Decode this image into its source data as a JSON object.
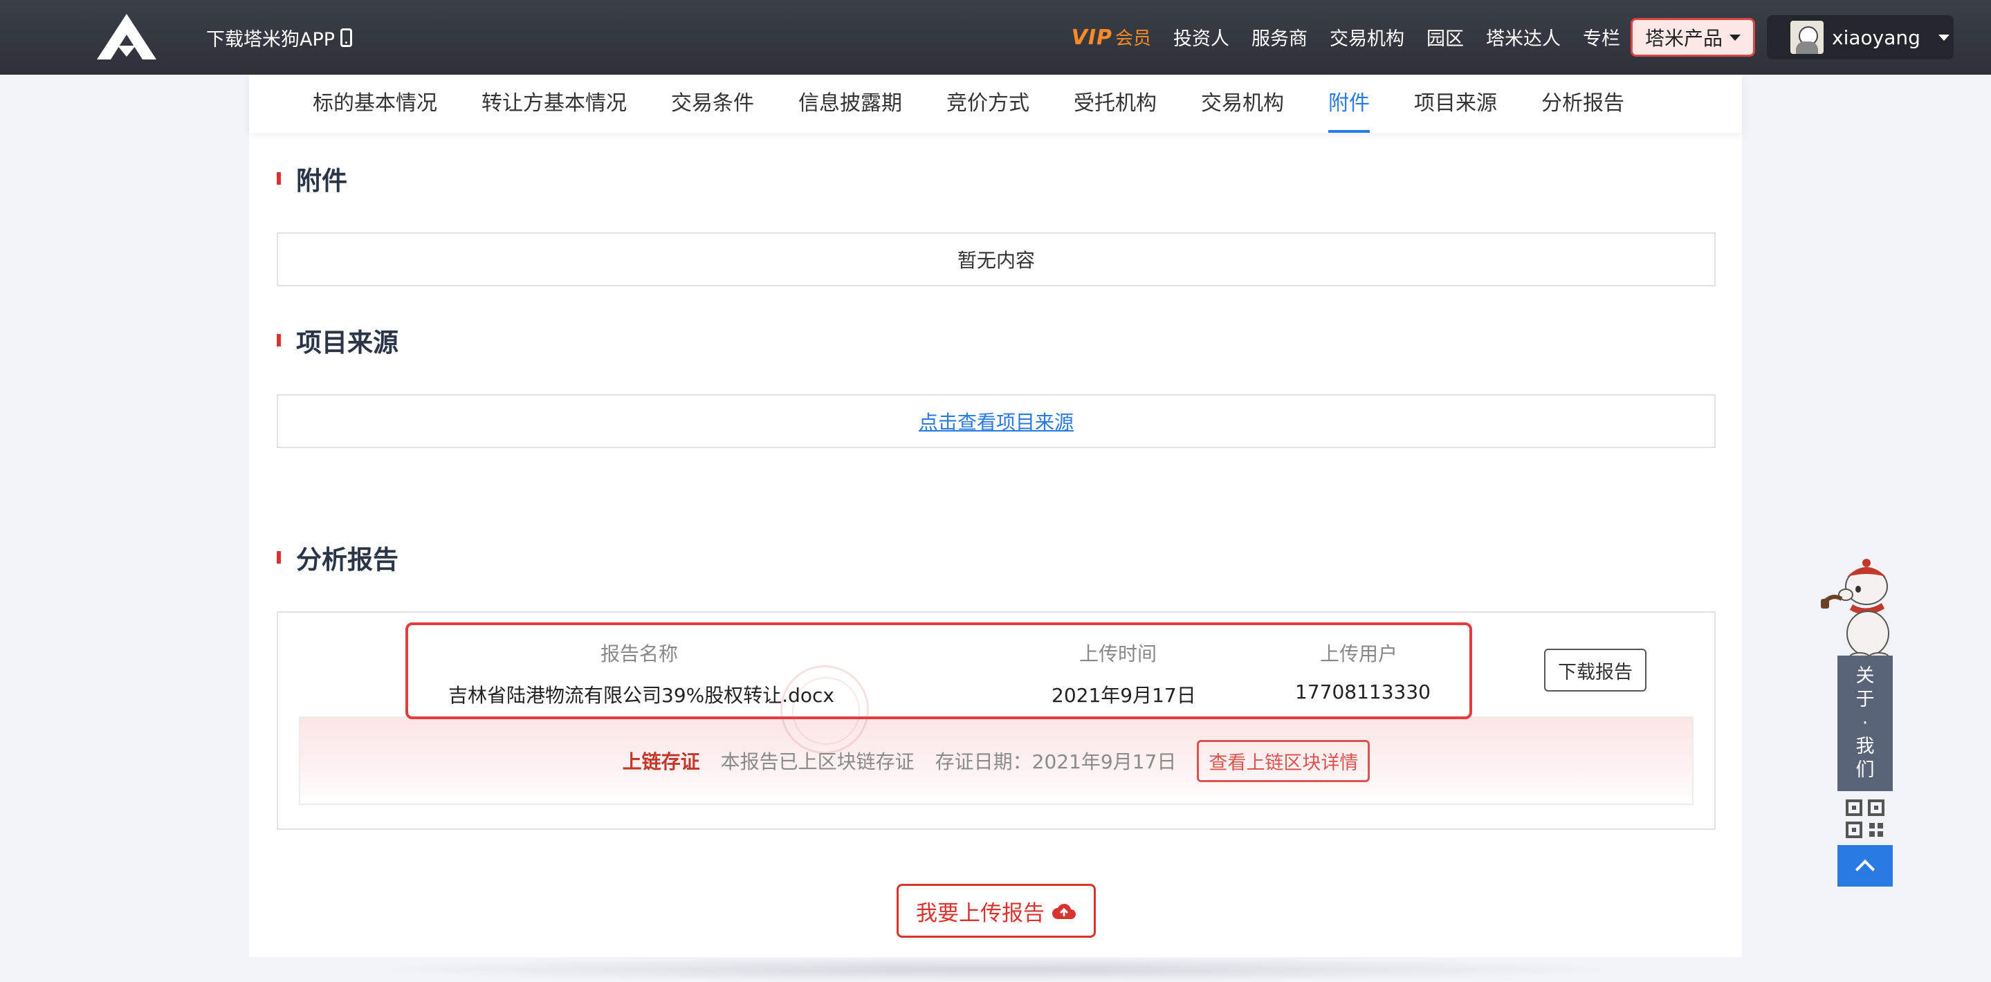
{
  "header": {
    "app_download": "下载塔米狗APP",
    "vip": {
      "mark": "VIP",
      "label": "会员"
    },
    "nav": [
      "投资人",
      "服务商",
      "交易机构",
      "园区",
      "塔米达人",
      "专栏"
    ],
    "product_menu": "塔米产品",
    "username": "xiaoyang"
  },
  "tabs": [
    {
      "label": "标的基本情况"
    },
    {
      "label": "转让方基本情况"
    },
    {
      "label": "交易条件"
    },
    {
      "label": "信息披露期"
    },
    {
      "label": "竞价方式"
    },
    {
      "label": "受托机构"
    },
    {
      "label": "交易机构"
    },
    {
      "label": "附件",
      "active": true
    },
    {
      "label": "项目来源"
    },
    {
      "label": "分析报告"
    }
  ],
  "attachments": {
    "title": "附件",
    "empty_text": "暂无内容"
  },
  "project_source": {
    "title": "项目来源",
    "link_text": "点击查看项目来源"
  },
  "analysis_report": {
    "title": "分析报告",
    "columns": {
      "name": "报告名称",
      "upload_time": "上传时间",
      "uploader": "上传用户"
    },
    "row": {
      "name": "吉林省陆港物流有限公司39%股权转让.docx",
      "upload_time": "2021年9月17日",
      "uploader": "17708113330"
    },
    "download_label": "下载报告",
    "chain": {
      "label": "上链存证",
      "status": "本报告已上区块链存证",
      "date": "存证日期：2021年9月17日",
      "detail_button": "查看上链区块详情"
    },
    "upload_button": "我要上传报告"
  },
  "side_widget": {
    "about": [
      "关",
      "于",
      "·",
      "我",
      "们"
    ]
  },
  "colors": {
    "accent_blue": "#2a7ae4",
    "brand_red": "#d9332f",
    "vip_orange": "#ff8a2a",
    "navbar": "#2e3138"
  }
}
